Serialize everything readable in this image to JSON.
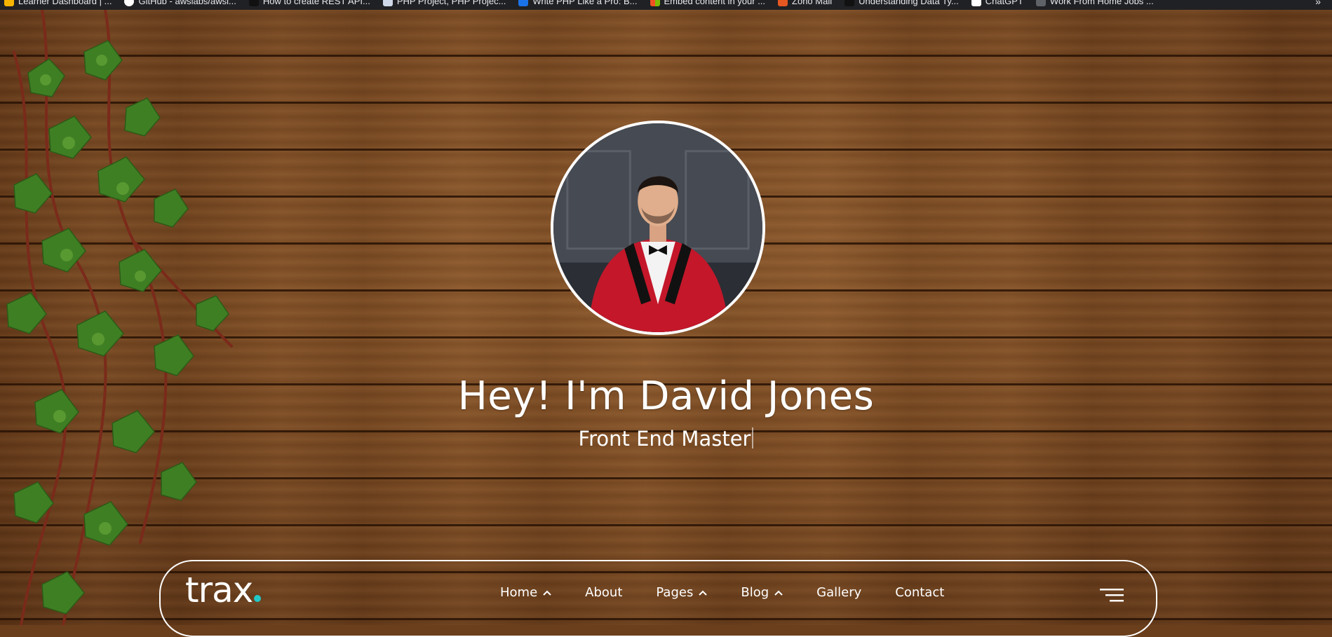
{
  "bookmarks_bar": {
    "items": [
      {
        "label": "Learner Dashboard | ...",
        "icon": "bookmark-favicon",
        "color": "#f4b400"
      },
      {
        "label": "GitHub - awslabs/awsl...",
        "icon": "github-icon",
        "color": "#ffffff"
      },
      {
        "label": "How to create REST API...",
        "icon": "bookmark-favicon",
        "color": "#111111"
      },
      {
        "label": "PHP Project, PHP Projec...",
        "icon": "bookmark-favicon",
        "color": "#cfd8e6"
      },
      {
        "label": "Write PHP Like a Pro: B...",
        "icon": "bookmark-favicon",
        "color": "#1a73e8"
      },
      {
        "label": "Embed content in your ...",
        "icon": "microsoft-icon",
        "color": "#f25022"
      },
      {
        "label": "Zoho Mail",
        "icon": "bookmark-favicon",
        "color": "#e65722"
      },
      {
        "label": "Understanding Data Ty...",
        "icon": "bookmark-favicon",
        "color": "#111111"
      },
      {
        "label": "ChatGPT",
        "icon": "chatgpt-icon",
        "color": "#ffffff"
      },
      {
        "label": "Work From Home Jobs ...",
        "icon": "bookmark-favicon",
        "color": "#5f6368"
      }
    ],
    "overflow": "»"
  },
  "hero": {
    "headline": "Hey! I'm David Jones",
    "subtitle": "Front End Master"
  },
  "nav": {
    "logo": "trax",
    "logo_dot_color": "#22c8c8",
    "items": [
      {
        "label": "Home",
        "has_dropdown": true
      },
      {
        "label": "About",
        "has_dropdown": false
      },
      {
        "label": "Pages",
        "has_dropdown": true
      },
      {
        "label": "Blog",
        "has_dropdown": true
      },
      {
        "label": "Gallery",
        "has_dropdown": false
      },
      {
        "label": "Contact",
        "has_dropdown": false
      }
    ],
    "menu_icon": "hamburger-menu-icon"
  },
  "colors": {
    "text": "#ffffff",
    "wood": "#7a4921",
    "jacket": "#c4172a"
  }
}
